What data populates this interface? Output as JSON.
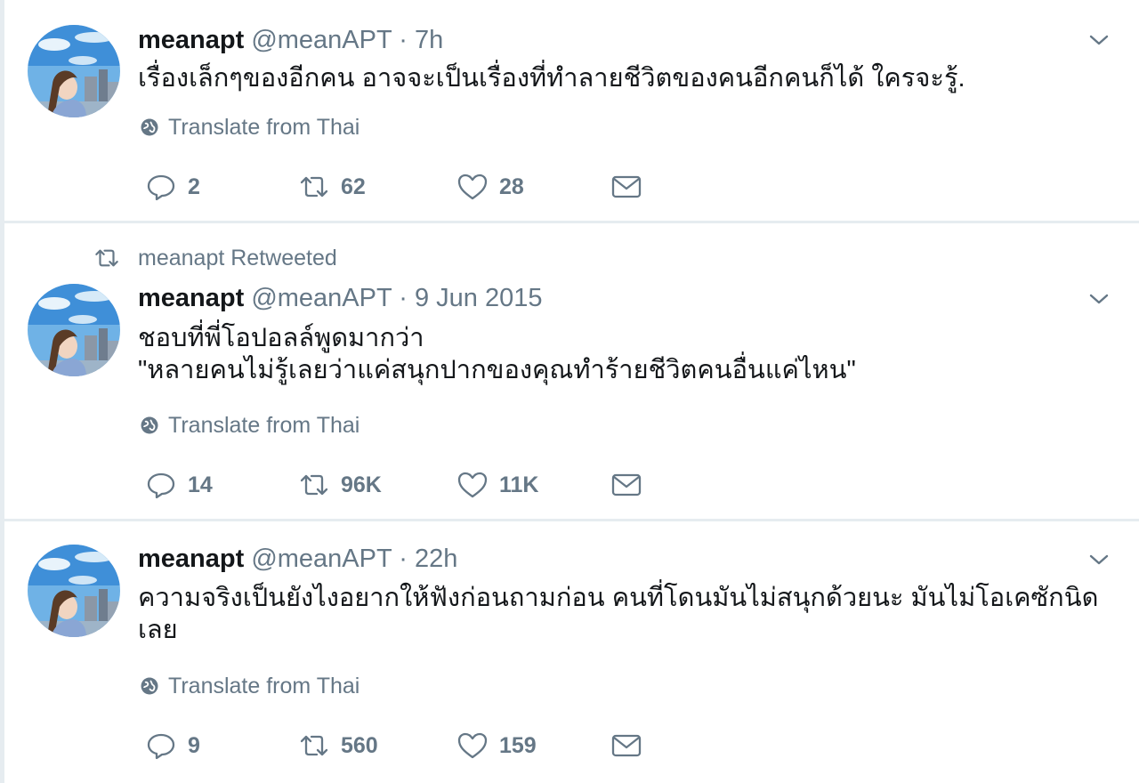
{
  "tweets": [
    {
      "name": "meanapt",
      "handle": "@meanAPT",
      "separator": "·",
      "time": "7h",
      "text": "เรื่องเล็กๆของอีกคน อาจจะเป็นเรื่องที่ทำลายชีวิตของคนอีกคนก็ได้ ใครจะรู้.",
      "translate_label": "Translate from Thai",
      "replies": "2",
      "retweets": "62",
      "likes": "28"
    },
    {
      "retweet_context": "meanapt Retweeted",
      "name": "meanapt",
      "handle": "@meanAPT",
      "separator": "·",
      "time": "9 Jun 2015",
      "text_line1": "ชอบที่พี่โอปอลล์พูดมากว่า",
      "text_line2": "\"หลายคนไม่รู้เลยว่าแค่สนุกปากของคุณทำร้ายชีวิตคนอื่นแค่ไหน\"",
      "translate_label": "Translate from Thai",
      "replies": "14",
      "retweets": "96K",
      "likes": "11K"
    },
    {
      "name": "meanapt",
      "handle": "@meanAPT",
      "separator": "·",
      "time": "22h",
      "text_line1": "ความจริงเป็นยังไงอยากให้ฟังก่อนถามก่อน คนที่โดนมันไม่สนุกด้วยนะ มันไม่โอเคซักนิด",
      "text_line2": "เลย",
      "translate_label": "Translate from Thai",
      "replies": "9",
      "retweets": "560",
      "likes": "159"
    }
  ],
  "icons": {
    "globe": "globe-icon",
    "reply": "reply-icon",
    "retweet": "retweet-icon",
    "like": "heart-icon",
    "dm": "envelope-icon",
    "caret": "chevron-down-icon"
  },
  "colors": {
    "text": "#14171a",
    "secondary": "#657786",
    "divider": "#e6ecf0"
  }
}
